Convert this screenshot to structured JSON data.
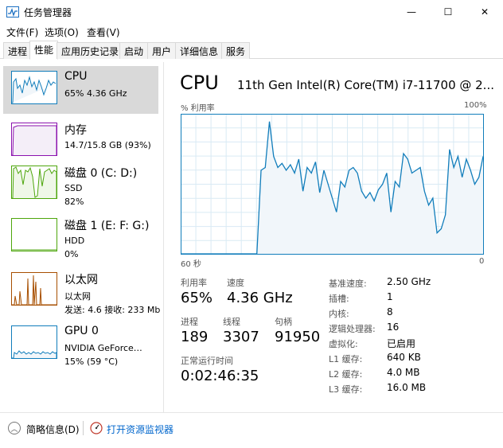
{
  "window": {
    "title": "任务管理器",
    "minimize": "—",
    "maximize": "☐",
    "close": "✕"
  },
  "menu": [
    "文件(F)",
    "选项(O)",
    "查看(V)"
  ],
  "tabs": [
    "进程",
    "性能",
    "应用历史记录",
    "启动",
    "用户",
    "详细信息",
    "服务"
  ],
  "resources": [
    {
      "title": "CPU",
      "line2": "65% 4.36 GHz",
      "line3": ""
    },
    {
      "title": "内存",
      "line2": "14.7/15.8 GB (93%)",
      "line3": ""
    },
    {
      "title": "磁盘 0 (C: D:)",
      "line2": "SSD",
      "line3": "82%"
    },
    {
      "title": "磁盘 1 (E: F: G:)",
      "line2": "HDD",
      "line3": "0%"
    },
    {
      "title": "以太网",
      "line2": "以太网",
      "line3": "发送: 4.6  接收: 233 Mb"
    },
    {
      "title": "GPU 0",
      "line2": "NVIDIA GeForce…",
      "line3": "15% (59 °C)"
    }
  ],
  "colors": {
    "cpu": "#117dbb",
    "memory": "#8b12ae",
    "disk": "#4da60c",
    "ethernet": "#a74f01",
    "gpu": "#117dbb",
    "link": "#0066cc",
    "selected": "#d9d9d9"
  },
  "detail": {
    "title": "CPU",
    "model": "11th Gen Intel(R) Core(TM) i7-11700 @ 2...",
    "util_axis_label": "% 利用率",
    "max_label": "100%",
    "x_left": "60 秒",
    "x_right": "0",
    "stats": {
      "utilization_label": "利用率",
      "utilization": "65%",
      "speed_label": "速度",
      "speed": "4.36 GHz",
      "processes_label": "进程",
      "processes": "189",
      "threads_label": "线程",
      "threads": "3307",
      "handles_label": "句柄",
      "handles": "91950",
      "uptime_label": "正常运行时间",
      "uptime": "0:02:46:35"
    },
    "specs": [
      {
        "label": "基准速度:",
        "value": "2.50 GHz"
      },
      {
        "label": "插槽:",
        "value": "1"
      },
      {
        "label": "内核:",
        "value": "8"
      },
      {
        "label": "逻辑处理器:",
        "value": "16"
      },
      {
        "label": "虚拟化:",
        "value": "已启用"
      },
      {
        "label": "L1 缓存:",
        "value": "640 KB"
      },
      {
        "label": "L2 缓存:",
        "value": "4.0 MB"
      },
      {
        "label": "L3 缓存:",
        "value": "16.0 MB"
      }
    ]
  },
  "chart_data": {
    "type": "area",
    "x_range": [
      60,
      0
    ],
    "ylim": [
      0,
      100
    ],
    "grid": true,
    "values": [
      0,
      0,
      0,
      0,
      0,
      0,
      0,
      0,
      0,
      0,
      0,
      0,
      0,
      0,
      0,
      0,
      0,
      0,
      0,
      60,
      62,
      95,
      70,
      62,
      65,
      60,
      64,
      58,
      68,
      45,
      62,
      58,
      66,
      44,
      60,
      50,
      40,
      30,
      52,
      48,
      60,
      62,
      58,
      45,
      40,
      44,
      38,
      46,
      50,
      58,
      30,
      52,
      48,
      72,
      68,
      58,
      60,
      62,
      45,
      35,
      40,
      15,
      18,
      28,
      75,
      62,
      70,
      55,
      68,
      60,
      50,
      55,
      70
    ],
    "xlabel": "",
    "ylabel": ""
  },
  "footer": {
    "fewer_details": "简略信息(D)",
    "open_monitor": "打开资源监视器"
  }
}
